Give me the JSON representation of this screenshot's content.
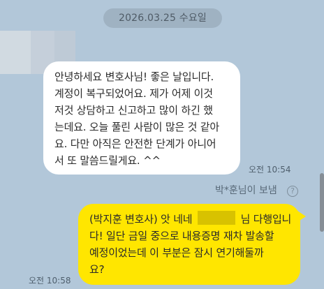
{
  "date_divider": "2026.03.25 수요일",
  "incoming": {
    "lines": [
      "안녕하세요 변호사님! 좋은 날입니다.",
      "계정이 복구되었어요. 제가 어제 이것",
      "저것 상담하고 신고하고 많이 하긴 했",
      "는데요. 오늘 풀린 사람이 많은 것 같아",
      "요. 다만 아직은 안전한 단계가 아니어",
      "서 또 말씀드릴게요. ^^"
    ],
    "time": "오전 10:54"
  },
  "sender_label": "박*훈님이 보냄",
  "outgoing": {
    "line1_pre": "(박지훈 변호사) 앗 네네",
    "line1_post": "님 다행입니",
    "line2": "다! 일단 금일 중으로 내용증명 재차 발송할",
    "line3": "예정이었는데 이 부분은 잠시 연기해둘까",
    "line4": "요?",
    "time": "오전 10:58"
  },
  "icons": {
    "help": "?",
    "help_icon_name": "help-circle-icon"
  },
  "colors": {
    "chat_background": "#b2c7d9",
    "incoming_bubble": "#ffffff",
    "outgoing_bubble": "#ffe600",
    "masked_name": "#d8c200"
  }
}
